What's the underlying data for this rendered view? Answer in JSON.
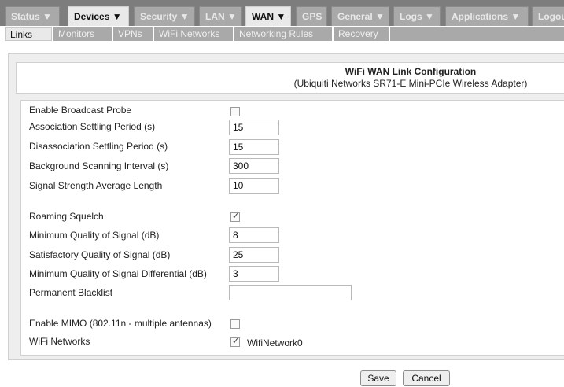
{
  "nav": {
    "main_tabs": [
      {
        "label": "Status ▼"
      },
      {
        "label": "Devices ▼"
      },
      {
        "label": "Security ▼"
      },
      {
        "label": "LAN ▼"
      },
      {
        "label": "WAN ▼"
      },
      {
        "label": "GPS"
      },
      {
        "label": "General ▼"
      },
      {
        "label": "Logs ▼"
      },
      {
        "label": "Applications ▼"
      },
      {
        "label": "Logout"
      }
    ],
    "active_main_tab": "WAN",
    "sub_tabs": [
      {
        "label": "Links"
      },
      {
        "label": "Monitors"
      },
      {
        "label": "VPNs"
      },
      {
        "label": "WiFi Networks"
      },
      {
        "label": "Networking Rules"
      },
      {
        "label": "Recovery"
      }
    ],
    "active_sub_tab": "Links"
  },
  "panel": {
    "title": "WiFi WAN Link Configuration",
    "subtitle": "(Ubiquiti Networks SR71-E Mini-PCIe Wireless Adapter)"
  },
  "fields": {
    "broadcast_probe": {
      "label": "Enable Broadcast Probe",
      "checked": false
    },
    "association_settling": {
      "label": "Association Settling Period (s)",
      "value": "15"
    },
    "disassociation_settling": {
      "label": "Disassociation Settling Period (s)",
      "value": "15"
    },
    "background_scanning": {
      "label": "Background Scanning Interval (s)",
      "value": "300"
    },
    "signal_strength_avg": {
      "label": "Signal Strength Average Length",
      "value": "10"
    },
    "roaming_squelch": {
      "label": "Roaming Squelch",
      "checked": true
    },
    "min_quality": {
      "label": "Minimum Quality of Signal (dB)",
      "value": "8"
    },
    "satisfactory_quality": {
      "label": "Satisfactory Quality of Signal (dB)",
      "value": "25"
    },
    "min_quality_diff": {
      "label": "Minimum Quality of Signal Differential (dB)",
      "value": "3"
    },
    "permanent_blacklist": {
      "label": "Permanent Blacklist",
      "value": ""
    },
    "enable_mimo": {
      "label": "Enable MIMO (802.11n - multiple antennas)",
      "checked": false
    },
    "wifi_networks": {
      "label": "WiFi Networks",
      "option_label": "WifiNetwork0",
      "checked": true
    }
  },
  "buttons": {
    "save": "Save",
    "cancel": "Cancel"
  }
}
